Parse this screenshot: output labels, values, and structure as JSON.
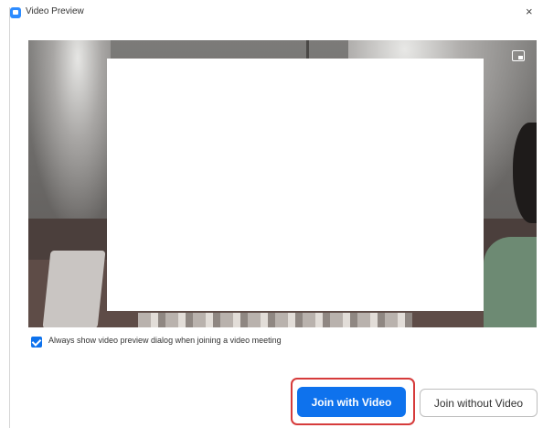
{
  "window": {
    "title": "Video Preview",
    "close_glyph": "×",
    "app_icon": "zoom-app-icon"
  },
  "preview": {
    "pip_icon": "picture-in-picture-icon"
  },
  "options": {
    "always_show_preview_label": "Always show video preview dialog when joining a video meeting",
    "always_show_preview_checked": true
  },
  "actions": {
    "join_with_video": "Join with Video",
    "join_without_video": "Join without Video"
  },
  "colors": {
    "accent": "#0e72ed",
    "highlight": "#d63b3b"
  }
}
